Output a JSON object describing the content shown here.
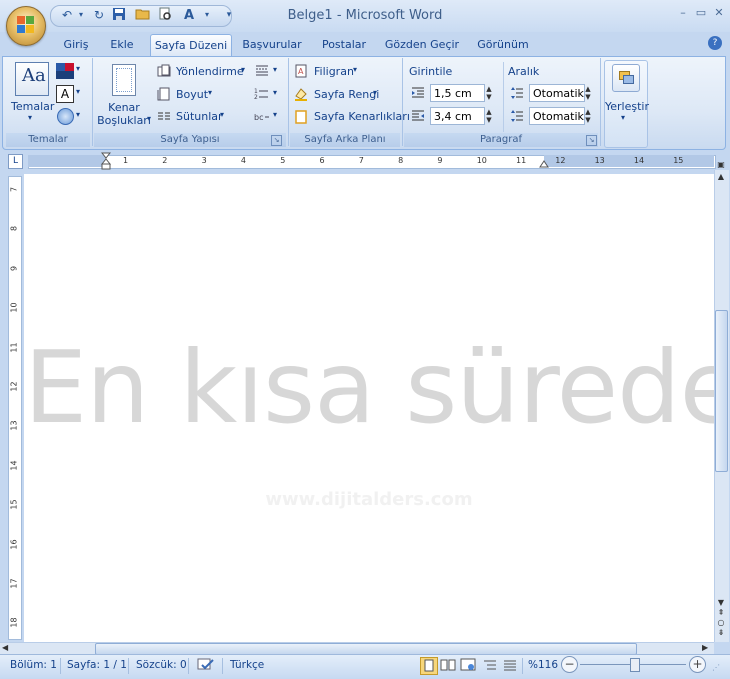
{
  "window": {
    "title": "Belge1 - Microsoft Word"
  },
  "qat": {
    "icons": [
      "undo-icon",
      "redo-icon",
      "save-icon",
      "open-icon",
      "print-preview-icon",
      "spelling-icon"
    ]
  },
  "tabs": [
    {
      "label": "Giriş"
    },
    {
      "label": "Ekle"
    },
    {
      "label": "Sayfa Düzeni"
    },
    {
      "label": "Başvurular"
    },
    {
      "label": "Postalar"
    },
    {
      "label": "Gözden Geçir"
    },
    {
      "label": "Görünüm"
    }
  ],
  "ribbon": {
    "themes": {
      "button_label": "Temalar",
      "group_label": "Temalar"
    },
    "page_setup": {
      "margins_label": "Kenar Boşlukları",
      "orientation_label": "Yönlendirme",
      "size_label": "Boyut",
      "columns_label": "Sütunlar",
      "group_label": "Sayfa Yapısı"
    },
    "page_background": {
      "watermark_label": "Filigran",
      "page_color_label": "Sayfa Rengi",
      "page_borders_label": "Sayfa Kenarlıkları",
      "group_label": "Sayfa Arka Planı"
    },
    "paragraph": {
      "indent_header": "Girintile",
      "spacing_header": "Aralık",
      "indent_left": "1,5 cm",
      "indent_right": "3,4 cm",
      "spacing_before": "Otomatik",
      "spacing_after": "Otomatik",
      "group_label": "Paragraf"
    },
    "arrange": {
      "button_label": "Yerleştir"
    }
  },
  "ruler": {
    "numbers": [
      "1",
      "2",
      "3",
      "4",
      "5",
      "6",
      "7",
      "8",
      "9",
      "10",
      "11",
      "12",
      "13",
      "14",
      "15"
    ],
    "vertical_numbers": [
      "7",
      "8",
      "9",
      "10",
      "11",
      "12",
      "13",
      "14",
      "15",
      "16",
      "17",
      "18"
    ]
  },
  "document": {
    "watermark_text": "En kısa sürede",
    "faint_site_text": "www.dijitalders.com"
  },
  "statusbar": {
    "section": "Bölüm: 1",
    "page": "Sayfa: 1 / 1",
    "words": "Sözcük: 0",
    "language": "Türkçe",
    "zoom": "%116"
  }
}
